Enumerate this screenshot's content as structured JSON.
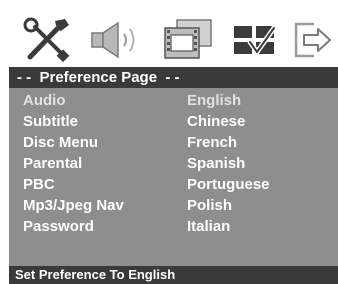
{
  "tabs": [
    {
      "name": "general-setup",
      "icon": "tools-icon"
    },
    {
      "name": "audio-setup",
      "icon": "speaker-icon"
    },
    {
      "name": "video-setup",
      "icon": "film-icon"
    },
    {
      "name": "preference-setup",
      "icon": "checkmark-grid-icon",
      "active": true
    },
    {
      "name": "exit",
      "icon": "exit-arrow-icon"
    }
  ],
  "page_title": "- -  Preference Page  - -",
  "menu": {
    "items": [
      "Audio",
      "Subtitle",
      "Disc Menu",
      "Parental",
      "PBC",
      "Mp3/Jpeg Nav",
      "Password"
    ],
    "selected": "Audio"
  },
  "options": {
    "items": [
      "English",
      "Chinese",
      "French",
      "Spanish",
      "Portuguese",
      "Polish",
      "Italian"
    ],
    "selected": "English"
  },
  "status": "Set Preference To English",
  "colors": {
    "panel": "#8e8e8e",
    "bar": "#3a3a3a",
    "text": "#ffffff",
    "icon_dark": "#3b3b3b",
    "icon_mid": "#7a7a7a",
    "icon_light": "#b8b8b8"
  }
}
